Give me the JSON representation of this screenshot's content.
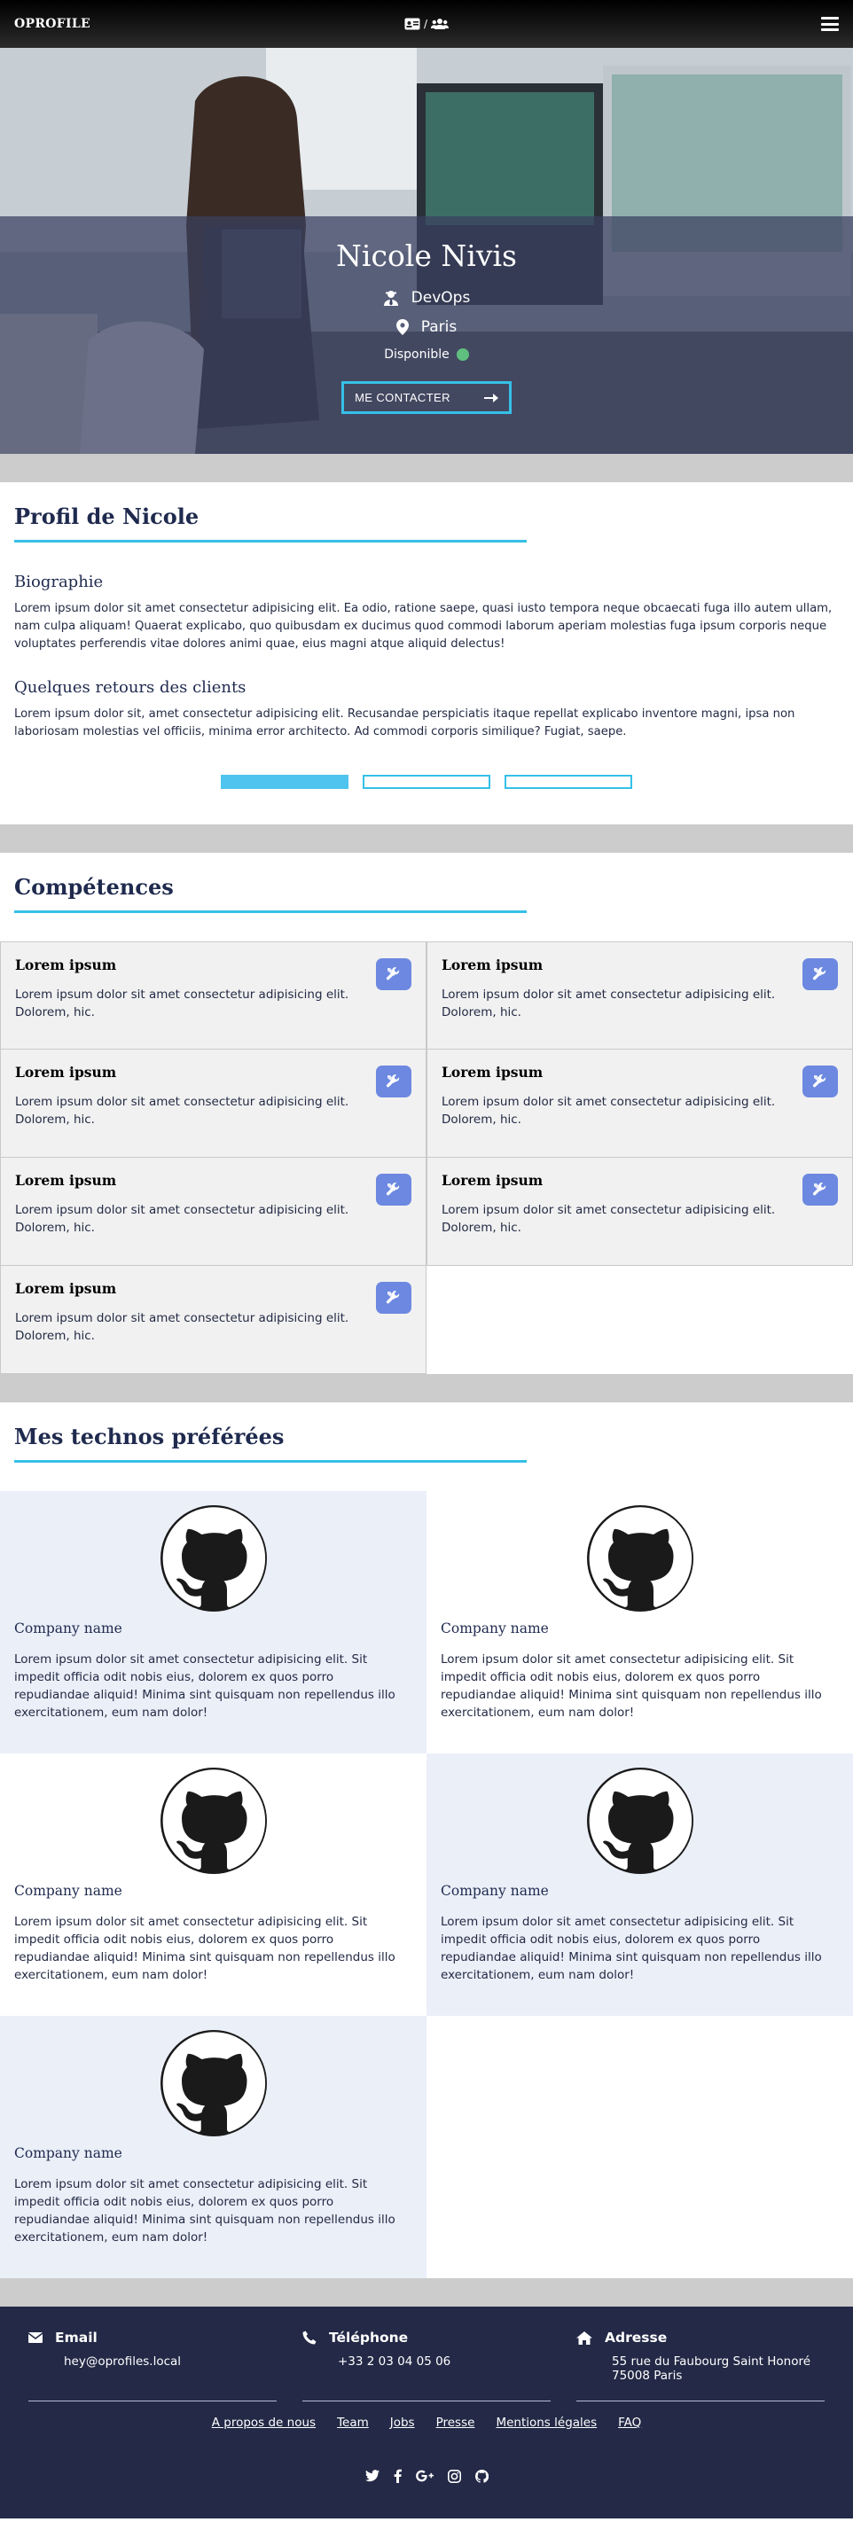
{
  "navbar": {
    "brand": "OPROFILE",
    "center_separator": "/",
    "icons": [
      "id-card-icon",
      "users-icon",
      "hamburger-menu-icon"
    ]
  },
  "hero": {
    "name": "Nicole Nivis",
    "role": "DevOps",
    "city": "Paris",
    "status": "Disponible",
    "status_color": "#5fbf7e",
    "contact_label": "ME CONTACTER"
  },
  "profile": {
    "title": "Profil de Nicole",
    "bio_title": "Biographie",
    "bio_text": "Lorem ipsum dolor sit amet consectetur adipisicing elit. Ea odio, ratione saepe, quasi iusto tempora neque obcaecati fuga illo autem ullam, nam culpa aliquam! Quaerat explicabo, quo quibusdam ex ducimus quod commodi laborum aperiam molestias fuga ipsum corporis neque voluptates perferendis vitae dolores animi quae, eius magni atque aliquid delectus!",
    "feedback_title": "Quelques retours des clients",
    "feedback_text": "Lorem ipsum dolor sit, amet consectetur adipisicing elit. Recusandae perspiciatis itaque repellat explicabo inventore magni, ipsa non laboriosam molestias vel officiis, minima error architecto. Ad commodi corporis similique? Fugiat, saepe.",
    "tabs": [
      {
        "active": true
      },
      {
        "active": false
      },
      {
        "active": false
      }
    ]
  },
  "skills": {
    "title": "Compétences",
    "items": [
      {
        "title": "Lorem ipsum",
        "text": "Lorem ipsum dolor sit amet consectetur adipisicing elit. Dolorem, hic."
      },
      {
        "title": "Lorem ipsum",
        "text": "Lorem ipsum dolor sit amet consectetur adipisicing elit. Dolorem, hic."
      },
      {
        "title": "Lorem ipsum",
        "text": "Lorem ipsum dolor sit amet consectetur adipisicing elit. Dolorem, hic."
      },
      {
        "title": "Lorem ipsum",
        "text": "Lorem ipsum dolor sit amet consectetur adipisicing elit. Dolorem, hic."
      },
      {
        "title": "Lorem ipsum",
        "text": "Lorem ipsum dolor sit amet consectetur adipisicing elit. Dolorem, hic."
      },
      {
        "title": "Lorem ipsum",
        "text": "Lorem ipsum dolor sit amet consectetur adipisicing elit. Dolorem, hic."
      },
      {
        "title": "Lorem ipsum",
        "text": "Lorem ipsum dolor sit amet consectetur adipisicing elit. Dolorem, hic."
      }
    ],
    "badge_icon": "tools-icon",
    "badge_color": "#6c88e0"
  },
  "technos": {
    "title": "Mes technos préférées",
    "items": [
      {
        "name": "Company name",
        "text": "Lorem ipsum dolor sit amet consectetur adipisicing elit. Sit impedit officia odit nobis eius, dolorem ex quos porro repudiandae aliquid! Minima sint quisquam non repellendus illo exercitationem, eum nam dolor!",
        "logo": "github-icon"
      },
      {
        "name": "Company name",
        "text": "Lorem ipsum dolor sit amet consectetur adipisicing elit. Sit impedit officia odit nobis eius, dolorem ex quos porro repudiandae aliquid! Minima sint quisquam non repellendus illo exercitationem, eum nam dolor!",
        "logo": "github-icon"
      },
      {
        "name": "Company name",
        "text": "Lorem ipsum dolor sit amet consectetur adipisicing elit. Sit impedit officia odit nobis eius, dolorem ex quos porro repudiandae aliquid! Minima sint quisquam non repellendus illo exercitationem, eum nam dolor!",
        "logo": "github-icon"
      },
      {
        "name": "Company name",
        "text": "Lorem ipsum dolor sit amet consectetur adipisicing elit. Sit impedit officia odit nobis eius, dolorem ex quos porro repudiandae aliquid! Minima sint quisquam non repellendus illo exercitationem, eum nam dolor!",
        "logo": "github-icon"
      },
      {
        "name": "Company name",
        "text": "Lorem ipsum dolor sit amet consectetur adipisicing elit. Sit impedit officia odit nobis eius, dolorem ex quos porro repudiandae aliquid! Minima sint quisquam non repellendus illo exercitationem, eum nam dolor!",
        "logo": "github-icon"
      }
    ]
  },
  "footer": {
    "email_label": "Email",
    "email_value": "hey@oprofiles.local",
    "phone_label": "Téléphone",
    "phone_value": "+33 2 03 04 05 06",
    "address_label": "Adresse",
    "address_line1": "55 rue du Faubourg Saint Honoré",
    "address_line2": "75008 Paris",
    "links": [
      "A propos de nous",
      "Team",
      "Jobs",
      "Presse",
      "Mentions légales",
      "FAQ"
    ],
    "socials": [
      "twitter-icon",
      "facebook-icon",
      "google-plus-icon",
      "instagram-icon",
      "github-icon"
    ]
  },
  "colors": {
    "accent": "#36c0e8",
    "navy": "#232946",
    "title": "#1f2a4e",
    "skill_card_bg": "#f1f1f1",
    "techno_blue_bg": "#eaeff8",
    "separator": "#cccccc"
  }
}
